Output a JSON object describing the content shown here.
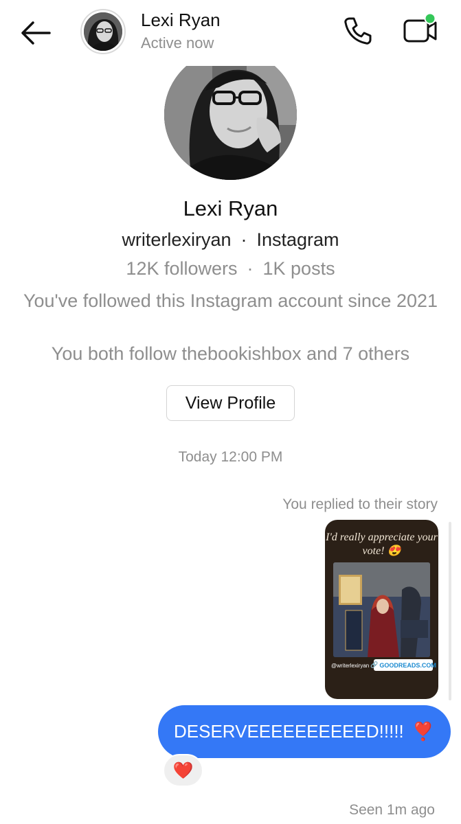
{
  "header": {
    "name": "Lexi Ryan",
    "status": "Active now"
  },
  "profile": {
    "name": "Lexi Ryan",
    "handle": "writerlexiryan",
    "platform": "Instagram",
    "separator": "·",
    "followers": "12K followers",
    "posts": "1K posts",
    "followed_since": "You've followed this Instagram account since 2021",
    "mutual": "You both follow thebookishbox and 7 others",
    "view_profile_label": "View Profile"
  },
  "conversation": {
    "timestamp": "Today 12:00 PM",
    "replied_label": "You replied to their story",
    "story": {
      "title": "I'd really appreciate your vote! 😍",
      "handle": "@writerlexiryan",
      "link": "GOODREADS.COM"
    },
    "message": "DESERVEEEEEEEEEED!!!!!",
    "message_heart": "❣️",
    "reaction": "❤️",
    "seen": "Seen 1m ago"
  },
  "colors": {
    "bubble": "#3478f6",
    "video_dot": "#34c759",
    "muted_text": "#8e8e8e"
  },
  "icons": {
    "back": "arrow-left-icon",
    "call": "phone-icon",
    "video": "video-camera-icon"
  }
}
